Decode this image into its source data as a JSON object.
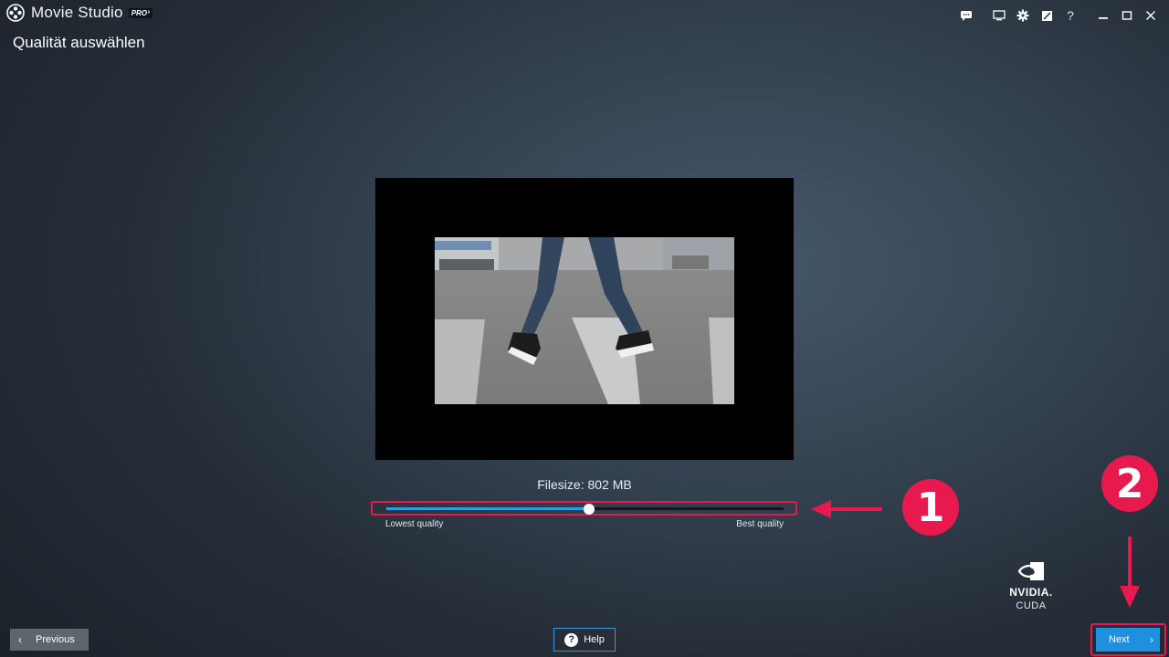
{
  "app": {
    "brand_small": "Movie Studio",
    "name": "Movie Studio",
    "badge": "PRO³",
    "logo_icon": "film-reel-icon"
  },
  "window_controls": {
    "icons": [
      "feedback-icon",
      "screen-icon",
      "settings-gear-icon",
      "edit-icon",
      "help-question-icon",
      "minimize-icon",
      "maximize-icon",
      "close-icon"
    ],
    "help_glyph": "?"
  },
  "page": {
    "title": "Qualität auswählen"
  },
  "preview": {
    "filesize_label": "Filesize: 802 MB"
  },
  "quality_slider": {
    "value": 0.51,
    "low_label": "Lowest quality",
    "high_label": "Best quality",
    "accent": "#2f9be0"
  },
  "annotations": {
    "marker1": "1",
    "marker2": "2",
    "color": "#e8194f"
  },
  "badge_nvidia": {
    "word": "NVIDIA.",
    "sub": "CUDA"
  },
  "footer": {
    "previous_label": "Previous",
    "help_label": "Help",
    "next_label": "Next",
    "next_color": "#1f8fe0"
  }
}
